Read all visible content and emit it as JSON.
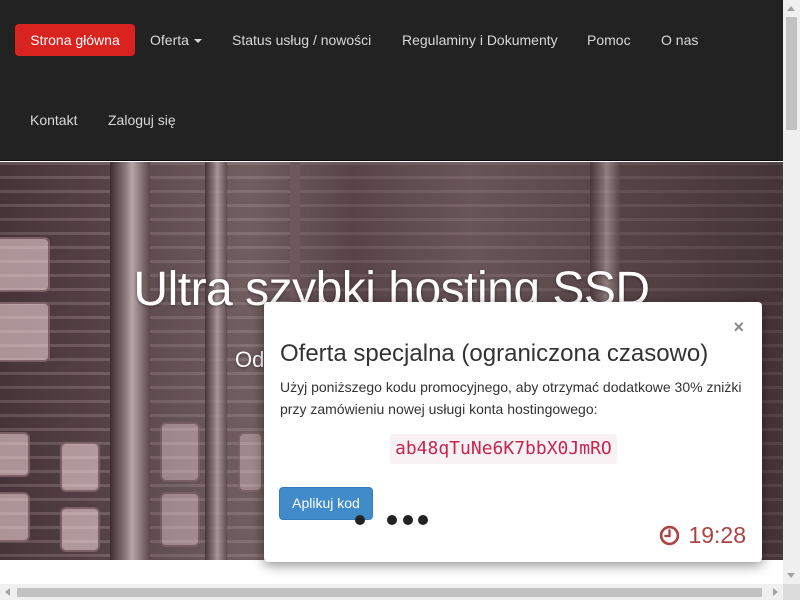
{
  "nav": {
    "home": "Strona główna",
    "offer": "Oferta",
    "status": "Status usług / nowości",
    "regulations": "Regulaminy i Dokumenty",
    "help": "Pomoc",
    "about": "O nas",
    "contact": "Kontakt",
    "login": "Zaloguj się"
  },
  "hero": {
    "title": "Ultra szybki hosting SSD",
    "subtitle_partial": "Od"
  },
  "modal": {
    "close": "×",
    "title": "Oferta specjalna (ograniczona czasowo)",
    "text": "Użyj poniższego kodu promocyjnego, aby otrzymać dodatkowe 30% zniżki przy zamówieniu nowej usługi konta hostingowego:",
    "promo_code": "ab48qTuNe6K7bbX0JmRO",
    "apply_button": "Aplikuj kod",
    "timer": "19:28"
  },
  "colors": {
    "nav_bg": "#222222",
    "active_nav": "#d9231f",
    "primary_button": "#428bca",
    "promo_text": "#c7254e",
    "timer": "#a94442"
  },
  "icons": {
    "timer_icon": "clock-icon",
    "dropdown_icon": "caret-down-icon",
    "close_icon": "close-icon"
  }
}
